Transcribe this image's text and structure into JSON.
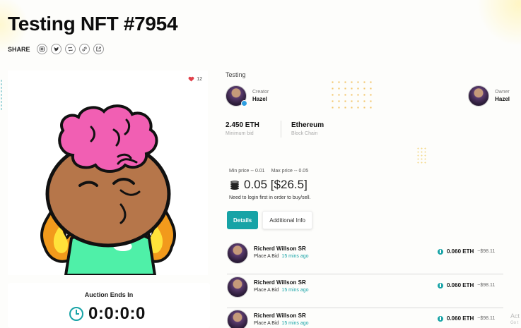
{
  "title": "Testing NFT #7954",
  "share": {
    "label": "SHARE",
    "icons": [
      "instagram-icon",
      "twitter-icon",
      "repost-icon",
      "link-icon",
      "external-icon"
    ]
  },
  "likes": {
    "count": "12"
  },
  "auction": {
    "label": "Auction Ends In",
    "timer": "0:0:0:0"
  },
  "collection": "Testing",
  "creator": {
    "role": "Creator",
    "name": "Hazel"
  },
  "owner": {
    "role": "Owner",
    "name": "Hazel"
  },
  "stats": {
    "price": {
      "value": "2.450 ETH",
      "sub": "Minimum bid"
    },
    "chain": {
      "value": "Ethereum",
      "sub": "Block Chain"
    }
  },
  "pricing": {
    "min": "Min price -- 0.01",
    "max": "Max price -- 0.05",
    "current": "0.05 [$26.5]",
    "note": "Need to login first in order to buy/sell."
  },
  "tabs": [
    {
      "label": "Details",
      "active": true
    },
    {
      "label": "Additional Info",
      "active": false
    }
  ],
  "bids": [
    {
      "name": "Richerd Willson SR",
      "action": "Place A Bid",
      "time": "15 mins ago",
      "eth": "0.060 ETH",
      "usd": "~$98.11"
    },
    {
      "name": "Richerd Willson SR",
      "action": "Place A Bid",
      "time": "15 mins ago",
      "eth": "0.060 ETH",
      "usd": "~$98.11"
    },
    {
      "name": "Richerd Willson SR",
      "action": "Place A Bid",
      "time": "15 mins ago",
      "eth": "0.060 ETH",
      "usd": "~$98.11"
    }
  ],
  "watermark": {
    "line1": "Act",
    "line2": "Go t"
  },
  "colors": {
    "accent": "#17a3a6",
    "heart": "#e0404a"
  }
}
